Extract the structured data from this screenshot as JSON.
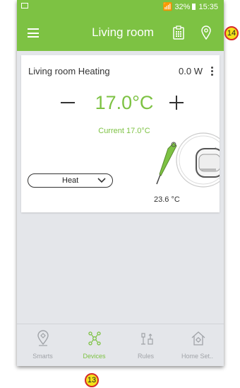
{
  "status_bar": {
    "indicators": "📶 32%",
    "time": "15:35"
  },
  "app_bar": {
    "title": "Living room",
    "menu_icon": "hamburger-menu-icon",
    "clipboard_icon": "clipboard-icon",
    "location_icon": "location-pin-icon"
  },
  "device_card": {
    "name": "Living room Heating",
    "power": "0.0 W",
    "setpoint": "17.0°C",
    "current": "Current 17.0°C",
    "mode": "Heat",
    "sensor_temperature": "23.6 °C"
  },
  "bottom_nav": {
    "items": [
      {
        "label": "Smarts",
        "icon": "smarts-icon",
        "active": false
      },
      {
        "label": "Devices",
        "icon": "devices-icon",
        "active": true
      },
      {
        "label": "Rules",
        "icon": "rules-icon",
        "active": false
      },
      {
        "label": "Home Set..",
        "icon": "home-settings-icon",
        "active": false
      }
    ]
  },
  "annotations": {
    "marker_top": "14",
    "marker_bottom": "13"
  },
  "colors": {
    "accent": "#7dc243",
    "marker_fill": "#f3e21a",
    "marker_border": "#d62a2a"
  }
}
